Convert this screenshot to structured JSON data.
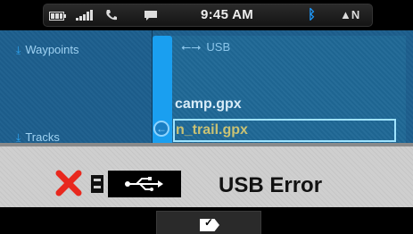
{
  "status": {
    "time": "9:45 AM",
    "compass": "N",
    "icons": [
      "battery-icon",
      "signal-icon",
      "phone-icon",
      "message-icon",
      "bluetooth-icon",
      "compass-icon"
    ]
  },
  "sidebar": {
    "items": [
      {
        "label": "Waypoints",
        "icon": "download-icon"
      },
      {
        "label": "Tracks",
        "icon": "download-icon"
      }
    ]
  },
  "browser": {
    "path": "USB",
    "files": [
      "camp.gpx",
      "n_trail.gpx"
    ],
    "selected_index": 1
  },
  "dialog": {
    "message": "USB Error",
    "icons": [
      "error-x-icon",
      "drive-icon",
      "usb-icon"
    ],
    "colors": {
      "error": "#e8281e"
    }
  },
  "footer": {
    "ok_icon": "ok-check-icon"
  },
  "colors": {
    "accent": "#1a9ff0",
    "panel": "#1d5f8e",
    "highlight": "#9fe3ff",
    "selected_text": "#c9c274",
    "bluetooth": "#1e9bff"
  }
}
